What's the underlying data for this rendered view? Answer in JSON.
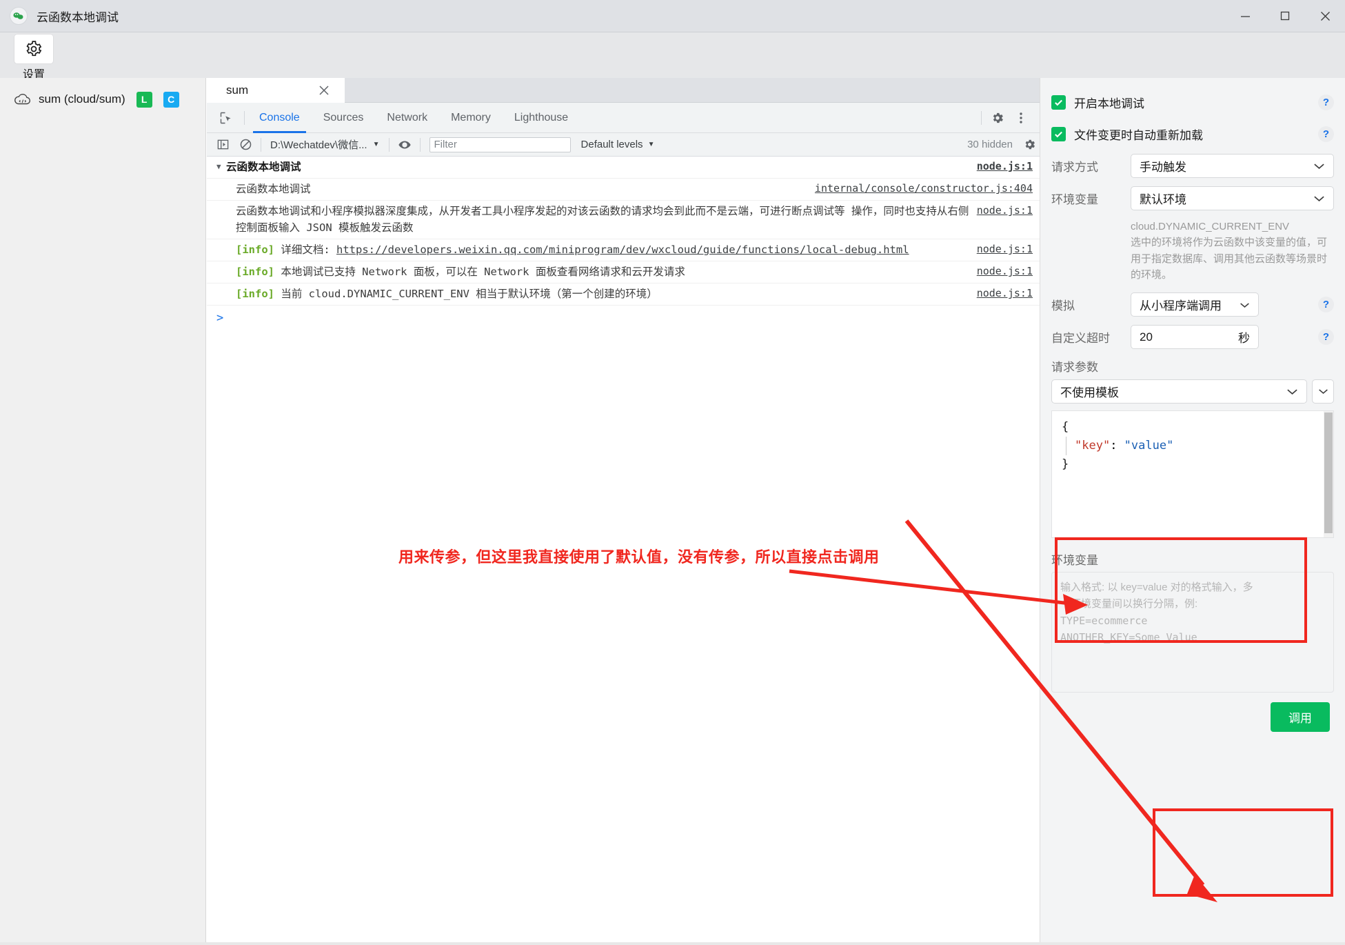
{
  "window": {
    "title": "云函数本地调试",
    "logo_icon": "wechat-devtools-logo",
    "minimize_label": "—",
    "maximize_label": "□",
    "close_label": "✕"
  },
  "toolstrip": {
    "settings_icon": "gear-icon",
    "settings_label": "设置"
  },
  "sidebar": {
    "function": {
      "cloud_icon": "cloud-function-icon",
      "name": "sum (cloud/sum)",
      "badges": [
        "L",
        "C"
      ]
    }
  },
  "devtools": {
    "file_tab": {
      "label": "sum",
      "close_icon": "close-icon"
    },
    "inspect_icon": "inspect-element-icon",
    "tabs": [
      {
        "label": "Console",
        "active": true
      },
      {
        "label": "Sources",
        "active": false
      },
      {
        "label": "Network",
        "active": false
      },
      {
        "label": "Memory",
        "active": false
      },
      {
        "label": "Lighthouse",
        "active": false
      }
    ],
    "settings_icon": "gear-icon",
    "more_icon": "more-vertical-icon",
    "console_toolbar": {
      "execute_icon": "execute-sidebar-icon",
      "clear_icon": "clear-console-icon",
      "context": "D:\\Wechatdev\\微信...",
      "context_caret": "▼",
      "eye_icon": "live-expression-eye-icon",
      "filter_placeholder": "Filter",
      "levels": "Default levels",
      "levels_caret": "▼",
      "hidden_count": "30 hidden",
      "console_settings_icon": "gear-icon"
    },
    "logs": [
      {
        "kind": "group",
        "triangle": "▼",
        "text": "云函数本地调试",
        "source": "node.js:1",
        "source_bold": true
      },
      {
        "kind": "plain",
        "text": "云函数本地调试",
        "source": "internal/console/constructor.js:404"
      },
      {
        "kind": "plain",
        "text": "云函数本地调试和小程序模拟器深度集成，从开发者工具小程序发起的对该云函数的请求均会到此而不是云端，可进行断点调试等 操作，同时也支持从右侧控制面板输入 JSON 模板触发云函数",
        "source": "node.js:1"
      },
      {
        "kind": "info",
        "tag": "[info]",
        "text": "详细文档: ",
        "link": "https://developers.weixin.qq.com/miniprogram/dev/wxcloud/guide/functions/local-debug.html",
        "source": "node.js:1"
      },
      {
        "kind": "info",
        "tag": "[info]",
        "text": "本地调试已支持 Network 面板，可以在 Network 面板查看网络请求和云开发请求",
        "source": "node.js:1"
      },
      {
        "kind": "info",
        "tag": "[info]",
        "text": "当前 cloud.DYNAMIC_CURRENT_ENV 相当于默认环境（第一个创建的环境）",
        "source": "node.js:1"
      }
    ],
    "prompt_symbol": ">"
  },
  "control_panel": {
    "checkboxes": [
      {
        "label": "开启本地调试",
        "checked": true,
        "help": "?"
      },
      {
        "label": "文件变更时自动重新加载",
        "checked": true,
        "help": "?"
      }
    ],
    "request_method": {
      "label": "请求方式",
      "value": "手动触发",
      "caret": "⌄"
    },
    "env_var": {
      "label": "环境变量",
      "value": "默认环境",
      "caret": "⌄"
    },
    "env_hint_title": "cloud.DYNAMIC_CURRENT_ENV",
    "env_hint_body": "选中的环境将作为云函数中该变量的值，可用于指定数据库、调用其他云函数等场景时的环境。",
    "simulate": {
      "label": "模拟",
      "value": "从小程序端调用",
      "caret": "⌄",
      "help": "?"
    },
    "timeout": {
      "label": "自定义超时",
      "value": "20",
      "unit": "秒",
      "help": "?"
    },
    "request_params_label": "请求参数",
    "template": {
      "value": "不使用模板",
      "caret": "⌄",
      "expand_caret": "⌄"
    },
    "json_editor": {
      "line1": "{",
      "key": "\"key\"",
      "colon": ": ",
      "value": "\"value\"",
      "line3": "}"
    },
    "env_section_label": "环境变量",
    "env_placeholder_line1": "输入格式: 以 key=value 对的格式输入，多",
    "env_placeholder_line2": "个环境变量间以换行分隔，例:",
    "env_placeholder_line3": "TYPE=ecommerce",
    "env_placeholder_line4": "ANOTHER_KEY=Some Value",
    "call_button": "调用",
    "accent_green": "#09bb5f",
    "accent_blue": "#1a73e8"
  },
  "annotations": {
    "note_text": "用来传参，但这里我直接使用了默认值，没有传参，所以直接点击调用",
    "color": "#f0271f"
  }
}
